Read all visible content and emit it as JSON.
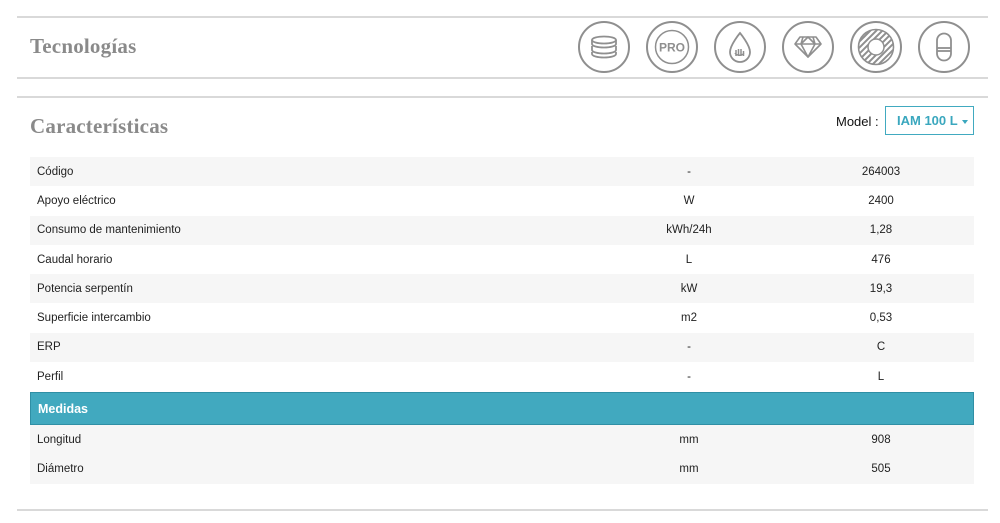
{
  "technologies": {
    "title": "Tecnologías",
    "icons": [
      {
        "name": "coil-stack-icon",
        "glyph": ""
      },
      {
        "name": "pro-icon",
        "glyph": "PRO"
      },
      {
        "name": "water-drop-hand-icon",
        "glyph": ""
      },
      {
        "name": "diamond-icon",
        "glyph": ""
      },
      {
        "name": "striped-disc-icon",
        "glyph": ""
      },
      {
        "name": "tank-icon",
        "glyph": ""
      }
    ]
  },
  "characteristics": {
    "title": "Características",
    "model_label": "Model :",
    "model_value": "IAM 100 L",
    "rows": [
      {
        "name": "Código",
        "unit": "-",
        "value": "264003"
      },
      {
        "name": "Apoyo eléctrico",
        "unit": "W",
        "value": "2400"
      },
      {
        "name": "Consumo de mantenimiento",
        "unit": "kWh/24h",
        "value": "1,28"
      },
      {
        "name": "Caudal horario",
        "unit": "L",
        "value": "476"
      },
      {
        "name": "Potencia serpentín",
        "unit": "kW",
        "value": "19,3"
      },
      {
        "name": "Superficie intercambio",
        "unit": "m2",
        "value": "0,53"
      },
      {
        "name": "ERP",
        "unit": "-",
        "value": "C"
      },
      {
        "name": "Perfil",
        "unit": "-",
        "value": "L"
      }
    ],
    "group_label": "Medidas",
    "group_rows": [
      {
        "name": "Longitud",
        "unit": "mm",
        "value": "908"
      },
      {
        "name": "Diámetro",
        "unit": "mm",
        "value": "505"
      }
    ]
  },
  "colors": {
    "accent": "#41a9bf",
    "rule": "#d9d9d9",
    "title": "#8a8a8a",
    "row_alt": "#f6f6f6"
  }
}
